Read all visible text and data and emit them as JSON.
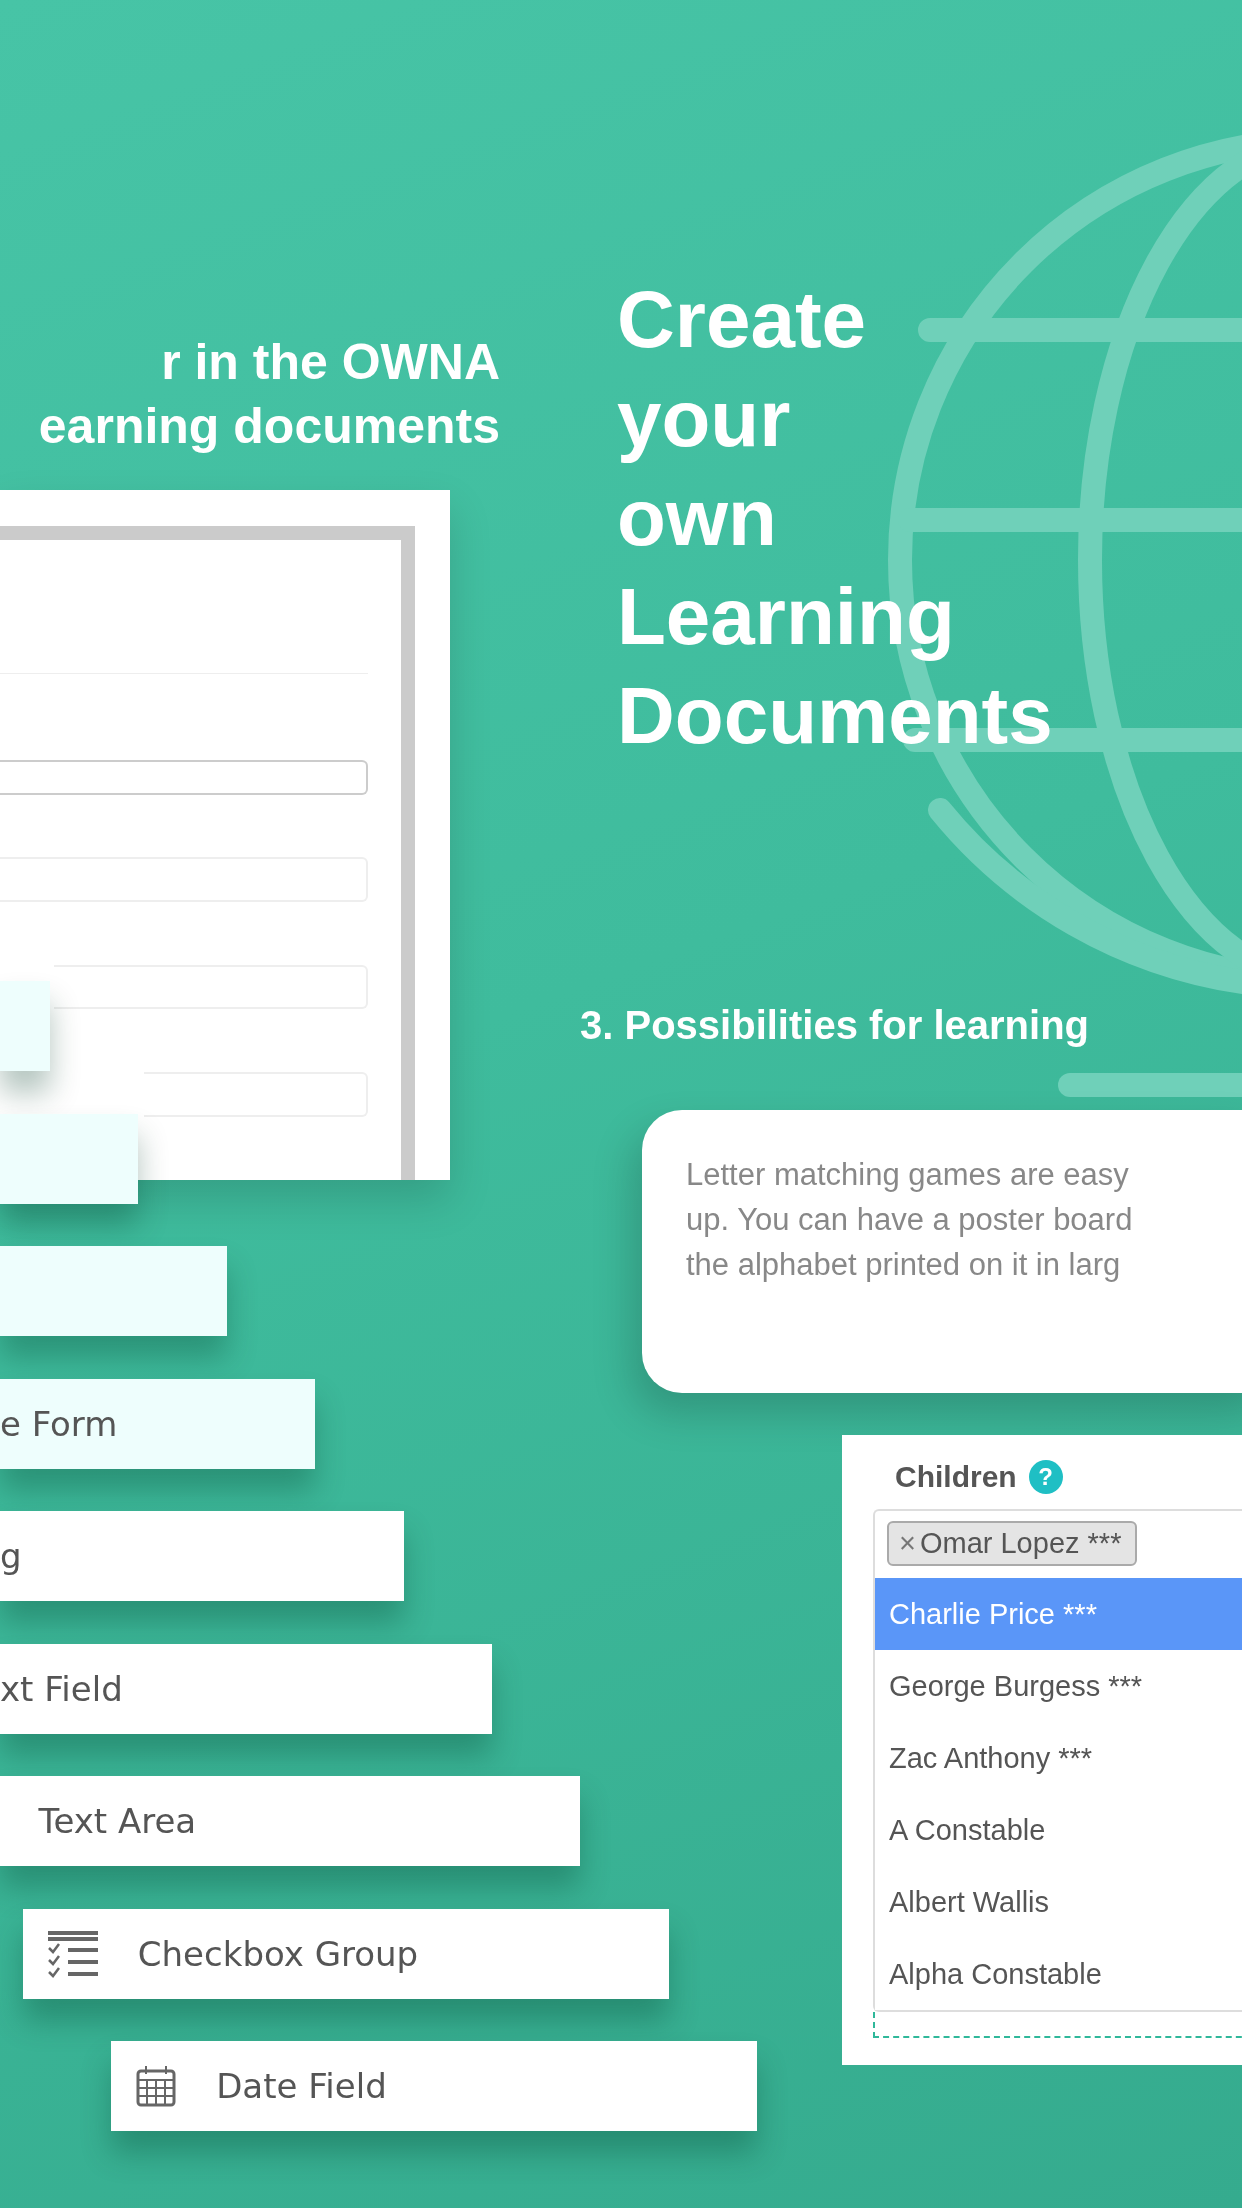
{
  "left_heading": [
    "r in the OWNA",
    "earning documents"
  ],
  "form_preview": {
    "inputs": [
      {
        "kind": "input"
      },
      {
        "kind": "input"
      },
      {
        "kind": "input"
      },
      {
        "kind": "input"
      }
    ]
  },
  "field_types": [
    {
      "kind": "blank",
      "highlighted": true
    },
    {
      "kind": "blank",
      "highlighted": true
    },
    {
      "kind": "blank",
      "highlighted": true
    },
    {
      "kind": "form",
      "label": "e Form",
      "highlighted": true
    },
    {
      "kind": "heading",
      "label": "g",
      "highlighted": false
    },
    {
      "kind": "text",
      "label": "xt Field",
      "highlighted": false
    },
    {
      "kind": "textarea",
      "label": "Text Area",
      "highlighted": false
    },
    {
      "kind": "checklist",
      "label": "Checkbox Group",
      "highlighted": false
    },
    {
      "kind": "date",
      "label": "Date Field",
      "highlighted": false
    }
  ],
  "promo_title": [
    "Create",
    "your",
    "own",
    "Learning",
    "Documents"
  ],
  "section_title": "3. Possibilities for learning",
  "example_text": [
    "Letter matching games are easy",
    "up. You can have a poster board",
    "the alphabet printed on it in larg"
  ],
  "children_field": {
    "label": "Children",
    "help": "?",
    "tags": [
      {
        "remove": "×",
        "name": "Omar Lopez ***"
      }
    ],
    "options": [
      {
        "name": "Charlie Price ***",
        "selected": true
      },
      {
        "name": "George Burgess ***",
        "selected": false
      },
      {
        "name": "Zac Anthony ***",
        "selected": false
      },
      {
        "name": "A Constable",
        "selected": false
      },
      {
        "name": "Albert Wallis",
        "selected": false
      },
      {
        "name": "Alpha Constable",
        "selected": false
      }
    ]
  }
}
